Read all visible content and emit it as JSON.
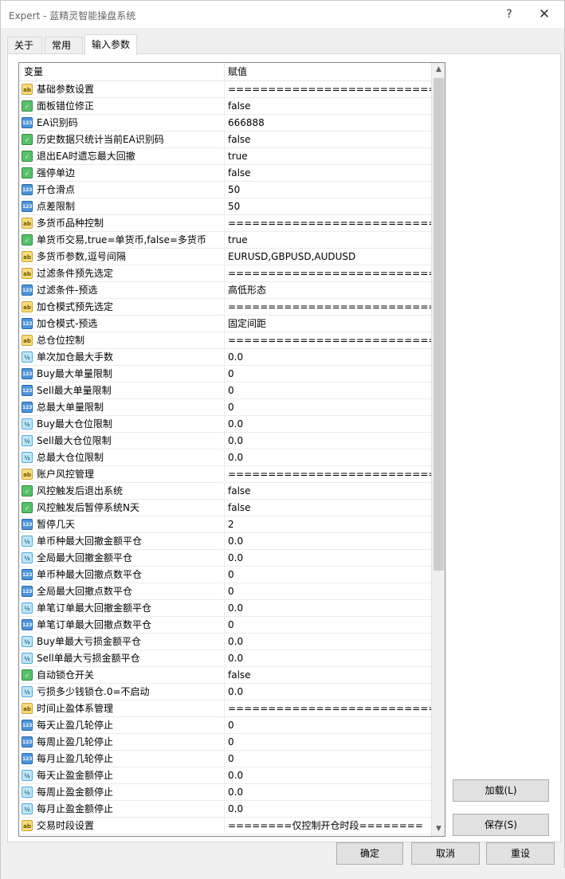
{
  "window": {
    "title": "Expert - 蓝精灵智能操盘系统",
    "help": "?",
    "close": "✕"
  },
  "tabs": [
    {
      "label": "关于"
    },
    {
      "label": "常用"
    },
    {
      "label": "输入参数",
      "active": true
    }
  ],
  "grid": {
    "col_variable": "变量",
    "col_value": "赋值",
    "rows": [
      {
        "type": "string",
        "badge": "ab",
        "name": "基础参数设置",
        "value": "===========================..."
      },
      {
        "type": "bool",
        "badge": "✓",
        "name": "面板错位修正",
        "value": "false"
      },
      {
        "type": "int",
        "badge": "123",
        "name": "EA识别码",
        "value": "666888"
      },
      {
        "type": "bool",
        "badge": "✓",
        "name": "历史数据只统计当前EA识别码",
        "value": "false"
      },
      {
        "type": "bool",
        "badge": "✓",
        "name": "退出EA时遗忘最大回撤",
        "value": "true"
      },
      {
        "type": "bool",
        "badge": "✓",
        "name": "强停单边",
        "value": "false"
      },
      {
        "type": "int",
        "badge": "123",
        "name": "开仓滑点",
        "value": "50"
      },
      {
        "type": "int",
        "badge": "123",
        "name": "点差限制",
        "value": "50"
      },
      {
        "type": "string",
        "badge": "ab",
        "name": "多货币品种控制",
        "value": "===========================..."
      },
      {
        "type": "bool",
        "badge": "✓",
        "name": "单货币交易,true=单货币,false=多货币",
        "value": "true"
      },
      {
        "type": "string",
        "badge": "ab",
        "name": "多货币参数,逗号间隔",
        "value": "EURUSD,GBPUSD,AUDUSD"
      },
      {
        "type": "string",
        "badge": "ab",
        "name": "过滤条件预先选定",
        "value": "===========================..."
      },
      {
        "type": "int",
        "badge": "123",
        "name": "过滤条件-预选",
        "value": "高低形态"
      },
      {
        "type": "string",
        "badge": "ab",
        "name": "加仓模式预先选定",
        "value": "===========================..."
      },
      {
        "type": "int",
        "badge": "123",
        "name": "加仓模式-预选",
        "value": "固定间距"
      },
      {
        "type": "string",
        "badge": "ab",
        "name": "总仓位控制",
        "value": "===========================..."
      },
      {
        "type": "double",
        "badge": "½",
        "name": "单次加仓最大手数",
        "value": "0.0"
      },
      {
        "type": "int",
        "badge": "123",
        "name": "Buy最大单量限制",
        "value": "0"
      },
      {
        "type": "int",
        "badge": "123",
        "name": "Sell最大单量限制",
        "value": "0"
      },
      {
        "type": "int",
        "badge": "123",
        "name": "总最大单量限制",
        "value": "0"
      },
      {
        "type": "double",
        "badge": "½",
        "name": "Buy最大仓位限制",
        "value": "0.0"
      },
      {
        "type": "double",
        "badge": "½",
        "name": "Sell最大仓位限制",
        "value": "0.0"
      },
      {
        "type": "double",
        "badge": "½",
        "name": "总最大仓位限制",
        "value": "0.0"
      },
      {
        "type": "string",
        "badge": "ab",
        "name": "账户风控管理",
        "value": "===========================..."
      },
      {
        "type": "bool",
        "badge": "✓",
        "name": "风控触发后退出系统",
        "value": "false"
      },
      {
        "type": "bool",
        "badge": "✓",
        "name": "风控触发后暂停系统N天",
        "value": "false"
      },
      {
        "type": "int",
        "badge": "123",
        "name": "暂停几天",
        "value": "2"
      },
      {
        "type": "double",
        "badge": "½",
        "name": "单币种最大回撤金额平仓",
        "value": "0.0"
      },
      {
        "type": "double",
        "badge": "½",
        "name": "全局最大回撤金额平仓",
        "value": "0.0"
      },
      {
        "type": "int",
        "badge": "123",
        "name": "单币种最大回撤点数平仓",
        "value": "0"
      },
      {
        "type": "int",
        "badge": "123",
        "name": "全局最大回撤点数平仓",
        "value": "0"
      },
      {
        "type": "double",
        "badge": "½",
        "name": "单笔订单最大回撤金额平仓",
        "value": "0.0"
      },
      {
        "type": "int",
        "badge": "123",
        "name": "单笔订单最大回撤点数平仓",
        "value": "0"
      },
      {
        "type": "double",
        "badge": "½",
        "name": "Buy单最大亏损金额平仓",
        "value": "0.0"
      },
      {
        "type": "double",
        "badge": "½",
        "name": "Sell单最大亏损金额平仓",
        "value": "0.0"
      },
      {
        "type": "bool",
        "badge": "✓",
        "name": "自动锁仓开关",
        "value": "false"
      },
      {
        "type": "double",
        "badge": "½",
        "name": "亏损多少钱锁仓.0=不启动",
        "value": "0.0"
      },
      {
        "type": "string",
        "badge": "ab",
        "name": "时间止盈体系管理",
        "value": "===========================..."
      },
      {
        "type": "int",
        "badge": "123",
        "name": "每天止盈几轮停止",
        "value": "0"
      },
      {
        "type": "int",
        "badge": "123",
        "name": "每周止盈几轮停止",
        "value": "0"
      },
      {
        "type": "int",
        "badge": "123",
        "name": "每月止盈几轮停止",
        "value": "0"
      },
      {
        "type": "double",
        "badge": "½",
        "name": "每天止盈金额停止",
        "value": "0.0"
      },
      {
        "type": "double",
        "badge": "½",
        "name": "每周止盈金额停止",
        "value": "0.0"
      },
      {
        "type": "double",
        "badge": "½",
        "name": "每月止盈金额停止",
        "value": "0.0"
      },
      {
        "type": "string",
        "badge": "ab",
        "name": "交易时段设置",
        "value": "========仅控制开仓时段========"
      }
    ]
  },
  "buttons": {
    "load": "加载(L)",
    "save": "保存(S)",
    "ok": "确定",
    "cancel": "取消",
    "reset": "重设"
  },
  "scroll_position_fraction": 0.0
}
